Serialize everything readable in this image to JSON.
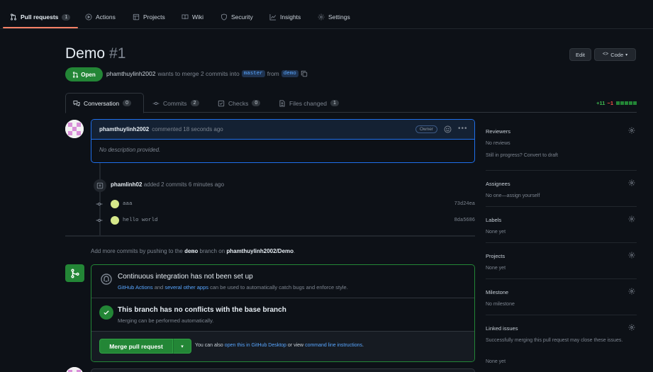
{
  "nav": {
    "items": [
      {
        "label": "Pull requests",
        "icon": "git-pull-request-icon",
        "count": "1"
      },
      {
        "label": "Actions",
        "icon": "play-icon"
      },
      {
        "label": "Projects",
        "icon": "table-icon"
      },
      {
        "label": "Wiki",
        "icon": "book-icon"
      },
      {
        "label": "Security",
        "icon": "shield-icon"
      },
      {
        "label": "Insights",
        "icon": "graph-icon"
      },
      {
        "label": "Settings",
        "icon": "gear-icon"
      }
    ]
  },
  "pr": {
    "title": "Demo",
    "number": "#1",
    "edit_label": "Edit",
    "code_label": "Code",
    "state": "Open",
    "author": "phamthuylinh2002",
    "meta_text1": "wants to merge 2 commits into",
    "base_branch": "master",
    "meta_text2": "from",
    "head_branch": "demo"
  },
  "tabs": [
    {
      "label": "Conversation",
      "count": "0"
    },
    {
      "label": "Commits",
      "count": "2"
    },
    {
      "label": "Checks",
      "count": "0"
    },
    {
      "label": "Files changed",
      "count": "1"
    }
  ],
  "diffstat": {
    "additions": "+11",
    "deletions": "−1"
  },
  "comment": {
    "author": "phamthuylinh2002",
    "action": "commented 18 seconds ago",
    "badge": "Owner",
    "body": "No description provided."
  },
  "commits_event": {
    "author": "phamlinh02",
    "text": "added 2 commits 6 minutes ago",
    "commits": [
      {
        "message": "aaa",
        "sha": "73d24ea"
      },
      {
        "message": "hello world",
        "sha": "8da5686"
      }
    ]
  },
  "push_hint": {
    "text1": "Add more commits by pushing to the",
    "branch": "demo",
    "text2": "branch on",
    "repo": "phamthuylinh2002/Demo",
    "text3": "."
  },
  "merge": {
    "ci_title": "Continuous integration has not been set up",
    "ci_link1": "GitHub Actions",
    "ci_text1": "and",
    "ci_link2": "several other apps",
    "ci_text2": "can be used to automatically catch bugs and enforce style.",
    "conflict_title": "This branch has no conflicts with the base branch",
    "conflict_sub": "Merging can be performed automatically.",
    "merge_label": "Merge pull request",
    "alt_text1": "You can also",
    "alt_link1": "open this in GitHub Desktop",
    "alt_text2": "or view",
    "alt_link2": "command line instructions",
    "alt_text3": "."
  },
  "sidebar": [
    {
      "title": "Reviewers",
      "lines": [
        "No reviews",
        "Still in progress? Convert to draft"
      ]
    },
    {
      "title": "Assignees",
      "lines": [
        "No one—assign yourself"
      ]
    },
    {
      "title": "Labels",
      "lines": [
        "None yet"
      ]
    },
    {
      "title": "Projects",
      "lines": [
        "None yet"
      ]
    },
    {
      "title": "Milestone",
      "lines": [
        "No milestone"
      ]
    },
    {
      "title": "Linked issues",
      "lines": [
        "Successfully merging this pull request may close these issues.",
        "None yet"
      ]
    }
  ],
  "colors": {
    "accent": "#f78166",
    "green": "#238636",
    "blue": "#58a6ff",
    "bg": "#0d1117"
  }
}
